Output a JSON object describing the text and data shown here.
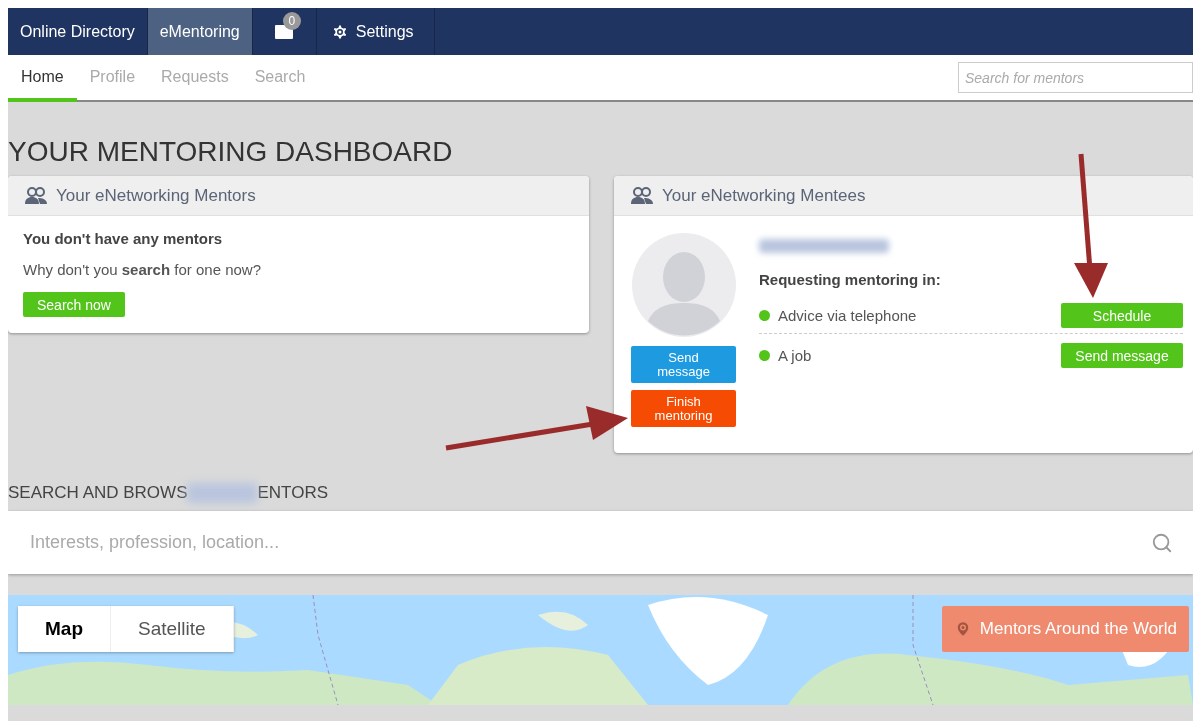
{
  "top_nav": [
    {
      "kind": "link",
      "label": "Online Directory",
      "selected": false
    },
    {
      "kind": "link",
      "label": "eMentoring",
      "selected": true
    },
    {
      "kind": "mail",
      "badge": "0",
      "selected": false
    },
    {
      "kind": "settings",
      "label": "Settings",
      "selected": false
    }
  ],
  "sub_nav": {
    "tabs": [
      {
        "label": "Home",
        "selected": true
      },
      {
        "label": "Profile",
        "selected": false
      },
      {
        "label": "Requests",
        "selected": false
      },
      {
        "label": "Search",
        "selected": false
      }
    ],
    "search": {
      "placeholder": "Search for mentors"
    }
  },
  "title": "YOUR MENTORING DASHBOARD",
  "mentors_card": {
    "title": "Your eNetworking Mentors",
    "empty_title": "You don't have any mentors",
    "prompt": "Why don't you **search** for one now?",
    "button": "Search now"
  },
  "mentees_card": {
    "title": "Your eNetworking Mentees",
    "send_button": "Send message",
    "finish_button": "Finish mentoring",
    "requesting_label": "Requesting mentoring in:",
    "requests": [
      {
        "label": "Advice via telephone",
        "color": "#52c41a",
        "button": "Schedule"
      },
      {
        "label": "A job",
        "color": "#52c41a",
        "button": "Send message"
      }
    ]
  },
  "browse": {
    "heading_start": "SEARCH AND BROWS",
    "heading_end": "ENTORS",
    "search": {
      "placeholder": "Interests, profession, location..."
    }
  },
  "map": {
    "types": [
      {
        "label": "Map",
        "selected": true
      },
      {
        "label": "Satellite",
        "selected": false
      }
    ],
    "button": "Mentors Around the World"
  }
}
